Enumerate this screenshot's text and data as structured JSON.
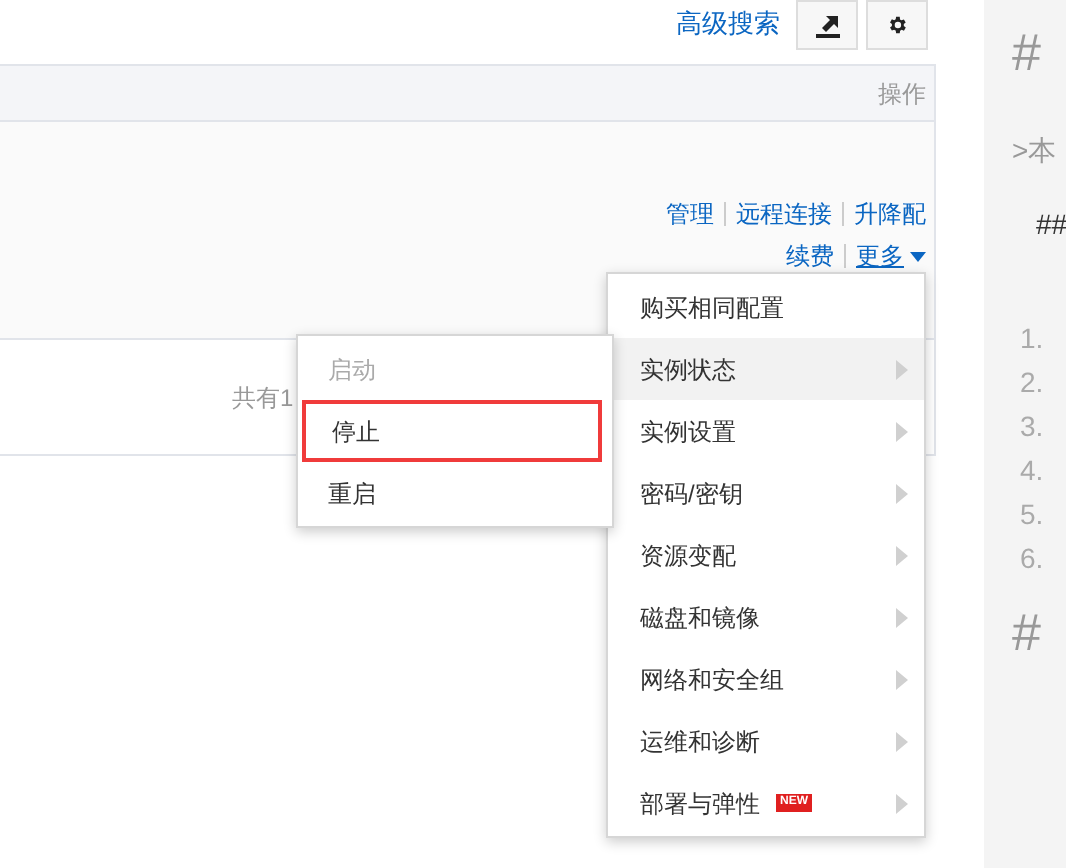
{
  "toolbar": {
    "advanced_search": "高级搜索"
  },
  "table": {
    "columns": [
      "操作"
    ],
    "row_actions": [
      {
        "label": "管理"
      },
      {
        "label": "远程连接"
      },
      {
        "label": "升降配"
      },
      {
        "label": "续费"
      },
      {
        "label": "更多"
      }
    ],
    "footer": "共有1"
  },
  "more_menu": {
    "items": [
      {
        "label": "购买相同配置",
        "has_submenu": false,
        "selected": false
      },
      {
        "label": "实例状态",
        "has_submenu": true,
        "selected": true
      },
      {
        "label": "实例设置",
        "has_submenu": true,
        "selected": false
      },
      {
        "label": "密码/密钥",
        "has_submenu": true,
        "selected": false
      },
      {
        "label": "资源变配",
        "has_submenu": true,
        "selected": false
      },
      {
        "label": "磁盘和镜像",
        "has_submenu": true,
        "selected": false
      },
      {
        "label": "网络和安全组",
        "has_submenu": true,
        "selected": false
      },
      {
        "label": "运维和诊断",
        "has_submenu": true,
        "selected": false
      },
      {
        "label": "部署与弹性",
        "has_submenu": true,
        "selected": false,
        "badge": "NEW"
      }
    ]
  },
  "submenu": {
    "items": [
      {
        "label": "启动",
        "disabled": true,
        "highlighted": false
      },
      {
        "label": "停止",
        "disabled": false,
        "highlighted": true
      },
      {
        "label": "重启",
        "disabled": false,
        "highlighted": false
      }
    ]
  },
  "editor": {
    "lines": [
      {
        "kind": "heading",
        "text": "#"
      },
      {
        "kind": "quote",
        "text": ">本"
      },
      {
        "kind": "subheading",
        "text": "##"
      },
      {
        "kind": "list",
        "text": "1."
      },
      {
        "kind": "list",
        "text": "2."
      },
      {
        "kind": "list",
        "text": "3."
      },
      {
        "kind": "list",
        "text": "4."
      },
      {
        "kind": "list",
        "text": "5."
      },
      {
        "kind": "list",
        "text": "6."
      },
      {
        "kind": "heading",
        "text": "#"
      }
    ]
  }
}
